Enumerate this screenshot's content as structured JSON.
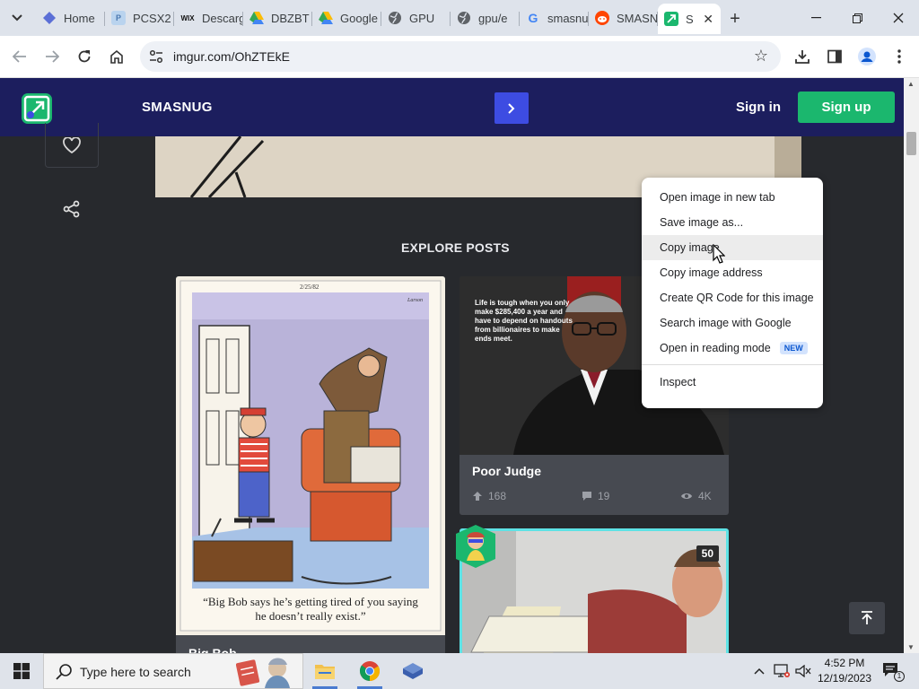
{
  "browser": {
    "tabs": [
      {
        "title": "Home",
        "favicon": "diamond-icon",
        "color": "#5b6fd6"
      },
      {
        "title": "PCSX2",
        "favicon": "pcsx2-icon",
        "color": "#7aa7d8"
      },
      {
        "title": "Descargas",
        "favicon": "wix-icon",
        "color": "#111111"
      },
      {
        "title": "DBZBT",
        "favicon": "drive-icon",
        "color": "#34a853"
      },
      {
        "title": "Google",
        "favicon": "drive-icon",
        "color": "#fbbc04"
      },
      {
        "title": "GPU",
        "favicon": "globe-icon",
        "color": "#5f6368"
      },
      {
        "title": "gpu/e",
        "favicon": "globe-icon",
        "color": "#5f6368"
      },
      {
        "title": "smasnug",
        "favicon": "google-icon",
        "color": "#4285f4"
      },
      {
        "title": "SMASNUG",
        "favicon": "reddit-icon",
        "color": "#ff4500"
      },
      {
        "title": "S",
        "favicon": "imgur-icon",
        "color": "#1bb76e",
        "active": true
      }
    ],
    "new_tab": "+",
    "url": "imgur.com/OhZTEkE"
  },
  "site": {
    "brand": "SMASNUG",
    "sign_in": "Sign in",
    "sign_up": "Sign up",
    "explore_heading": "EXPLORE POSTS",
    "colors": {
      "header": "#1c1e5e",
      "accent": "#1bb76e",
      "next": "#3d4ce2",
      "background": "#27292d"
    }
  },
  "posts": [
    {
      "title": "Big Bob",
      "date_stamp": "2/25/82",
      "signature": "Larson",
      "caption": "“Big Bob says he’s getting tired of you saying he doesn’t really exist.”"
    },
    {
      "title": "Poor Judge",
      "quote": "Life is tough when you only make $285,400 a year and have to depend on handouts from billionaires to make ends meet.",
      "upvotes": "168",
      "comments": "19",
      "views": "4K"
    },
    {
      "badge": "50"
    }
  ],
  "context_menu": {
    "items": [
      "Open image in new tab",
      "Save image as...",
      "Copy image",
      "Copy image address",
      "Create QR Code for this image",
      "Search image with Google",
      "Open in reading mode"
    ],
    "new_badge": "NEW",
    "inspect": "Inspect"
  },
  "taskbar": {
    "search_placeholder": "Type here to search",
    "time": "4:52 PM",
    "date": "12/19/2023",
    "notifications": "1"
  }
}
